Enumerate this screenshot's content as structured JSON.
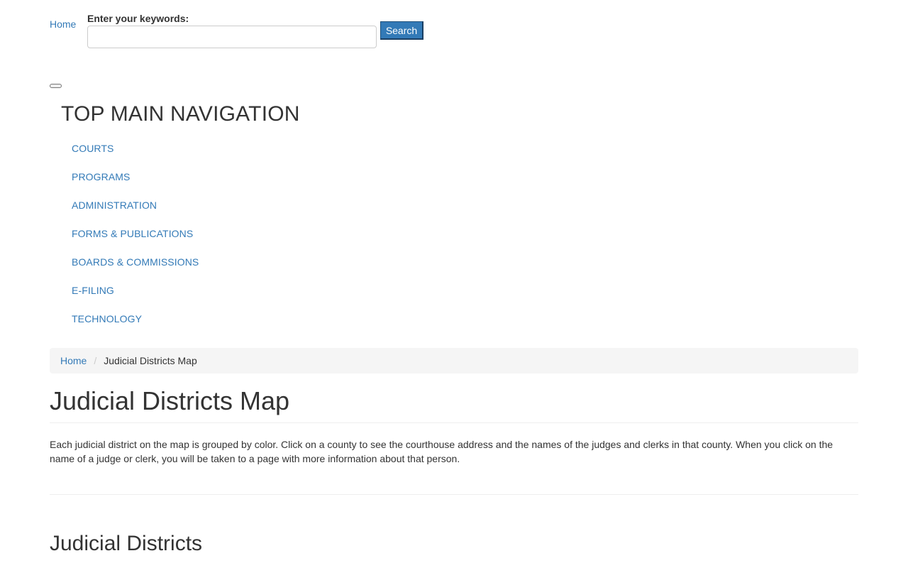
{
  "header": {
    "home_logo_alt": "Home",
    "search_label": "Enter your keywords:",
    "search_value": "",
    "search_button": "Search"
  },
  "nav": {
    "heading": "TOP MAIN NAVIGATION",
    "items": [
      {
        "label": "COURTS"
      },
      {
        "label": "PROGRAMS"
      },
      {
        "label": "ADMINISTRATION"
      },
      {
        "label": "FORMS & PUBLICATIONS"
      },
      {
        "label": "BOARDS & COMMISSIONS"
      },
      {
        "label": "E-FILING"
      },
      {
        "label": "TECHNOLOGY"
      }
    ]
  },
  "breadcrumb": {
    "home": "Home",
    "separator": "/",
    "current": "Judicial Districts Map"
  },
  "main": {
    "title": "Judicial Districts Map",
    "intro": "Each judicial district on the map is grouped by color. Click on a county to see the courthouse address and the names of the judges and clerks in that county. When you click on the name of a judge or clerk, you will be taken to a page with more information about that person.",
    "section_title": "Judicial Districts"
  },
  "colors": {
    "link": "#337ab7",
    "button_bg": "#337ab7",
    "text": "#333333",
    "breadcrumb_bg": "#f5f5f5"
  }
}
